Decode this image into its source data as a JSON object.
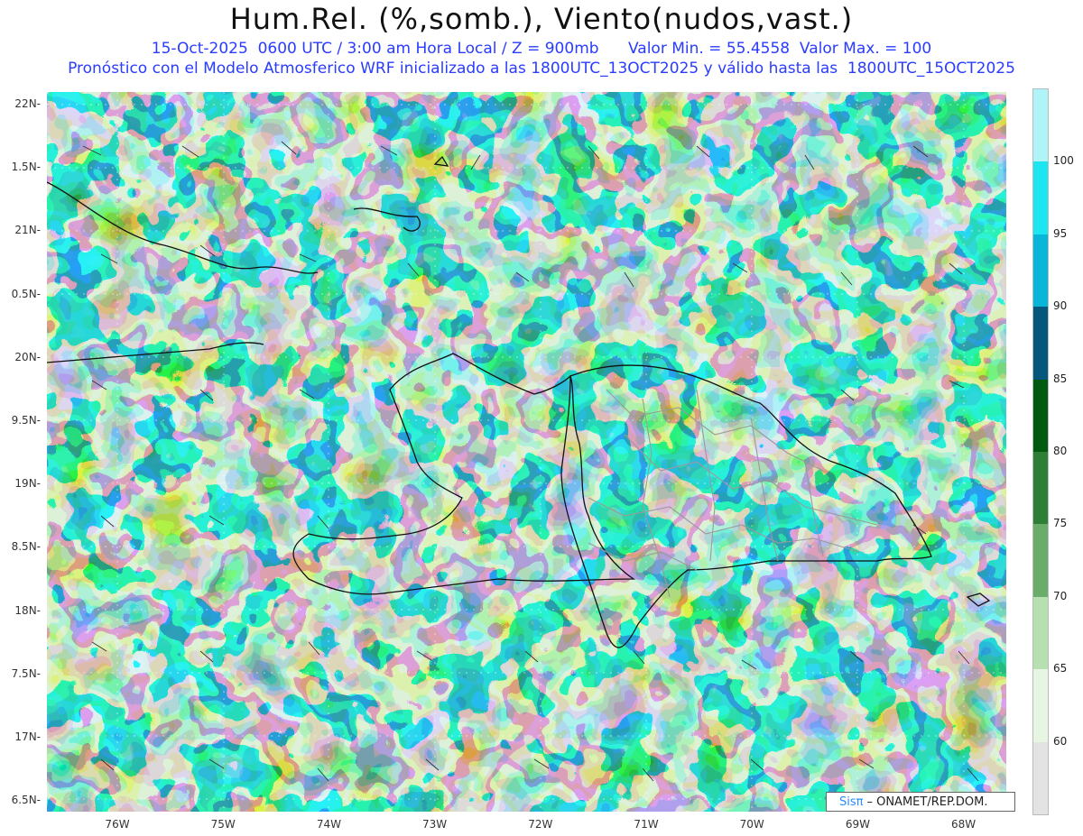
{
  "title": "Hum.Rel. (%,somb.), Viento(nudos,vast.)",
  "subtitle_1": "15-Oct-2025  0600 UTC / 3:00 am Hora Local / Z = 900mb      Valor Min. = 55.4558  Valor Max. = 100",
  "subtitle_2": "Pronóstico con el Modelo Atmosferico WRF inicializado a las 1800UTC_13OCT2025 y válido hasta las  1800UTC_15OCT2025",
  "lat_labels": [
    "22N",
    "1.5N",
    "21N",
    "0.5N",
    "20N",
    "9.5N",
    "19N",
    "8.5N",
    "18N",
    "7.5N",
    "17N",
    "6.5N"
  ],
  "lon_labels": [
    "76W",
    "75W",
    "74W",
    "73W",
    "72W",
    "71W",
    "70W",
    "69W",
    "68W"
  ],
  "colorbar": {
    "labels": [
      "100",
      "95",
      "90",
      "85",
      "80",
      "75",
      "70",
      "65",
      "60"
    ],
    "colors": [
      "#aff4f7",
      "#1ee6f0",
      "#08b6da",
      "#05587c",
      "#005a10",
      "#2e7f36",
      "#6aad6a",
      "#b7e0b0",
      "#e6f6e3",
      "#e3e3e3"
    ]
  },
  "credit": {
    "logo": "Sisπ",
    "text": "– ONAMET/REP.DOM."
  }
}
